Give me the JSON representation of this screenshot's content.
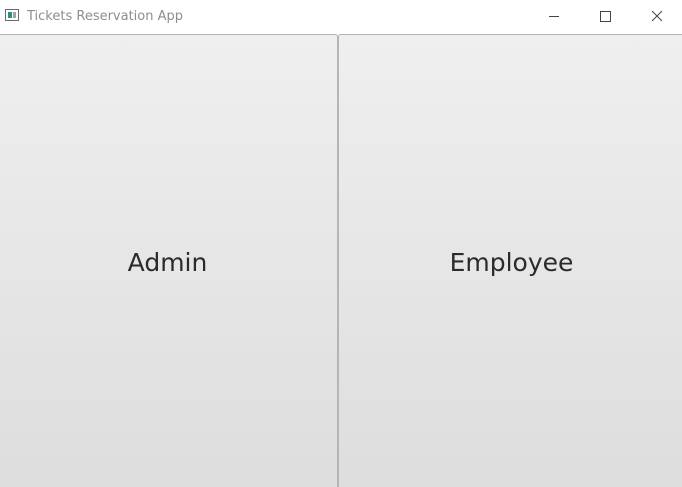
{
  "window": {
    "title": "Tickets Reservation App",
    "controls": {
      "minimize_icon": "minimize-icon",
      "maximize_icon": "maximize-icon",
      "close_icon": "close-icon"
    }
  },
  "main": {
    "buttons": [
      {
        "label": "Admin"
      },
      {
        "label": "Employee"
      }
    ]
  },
  "colors": {
    "button_top": "#efefef",
    "button_bottom": "#dddddd",
    "button_border": "#b5b5b5",
    "title_text": "#8e8e8e",
    "label_text": "#2b2b2b"
  }
}
